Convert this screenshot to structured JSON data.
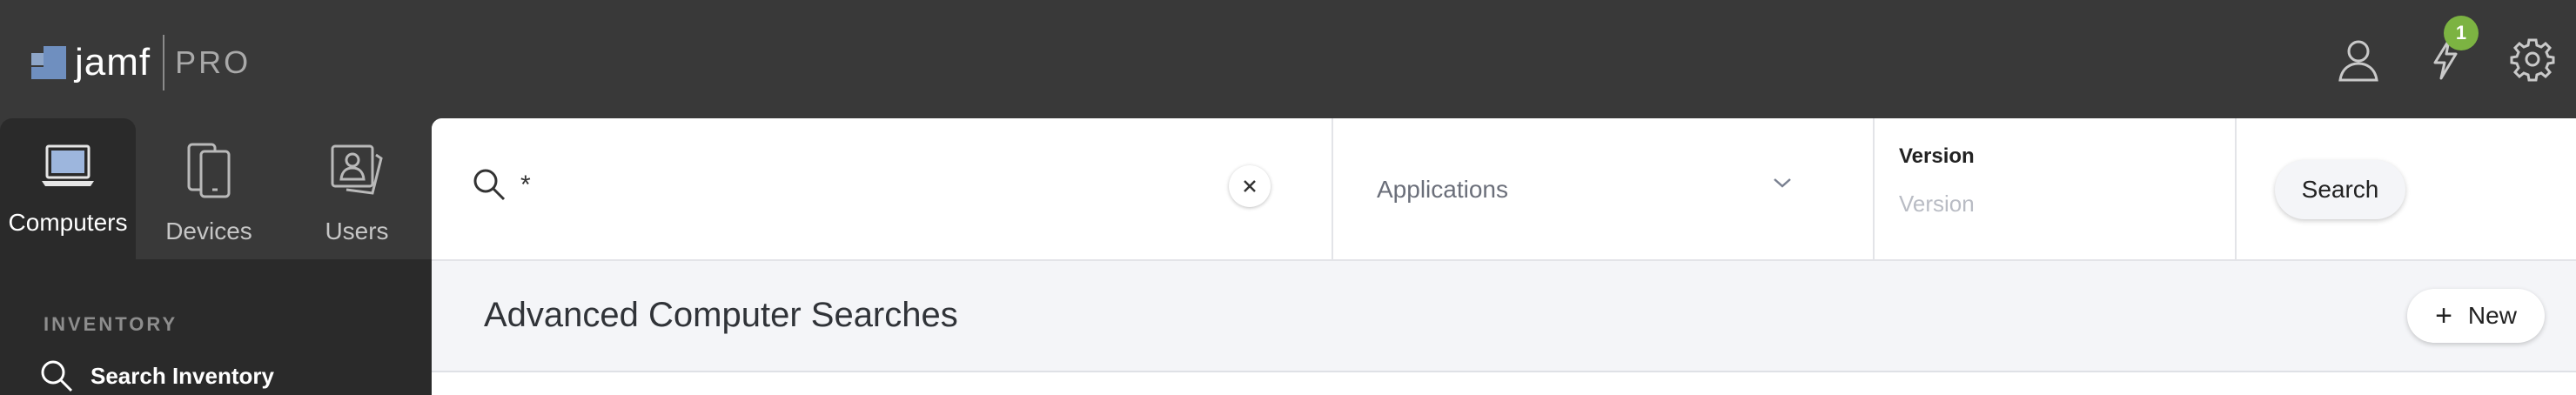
{
  "header": {
    "brand": "jamf",
    "product": "PRO",
    "notification_count": "1",
    "icons": [
      "user-account-icon",
      "lightning-notifications-icon",
      "gear-settings-icon"
    ]
  },
  "nav": {
    "tabs": [
      {
        "label": "Computers",
        "icon": "laptop-icon",
        "active": true
      },
      {
        "label": "Devices",
        "icon": "mobile-devices-icon",
        "active": false
      },
      {
        "label": "Users",
        "icon": "users-icon",
        "active": false
      }
    ]
  },
  "sidebar": {
    "section_label": "INVENTORY",
    "items": [
      {
        "label": "Search Inventory",
        "icon": "search-icon"
      }
    ]
  },
  "search": {
    "query": "*",
    "category": "Applications",
    "version_label": "Version",
    "version_placeholder": "Version",
    "search_button": "Search"
  },
  "page": {
    "title": "Advanced Computer Searches",
    "new_button": "New"
  },
  "colors": {
    "header_bg": "#393939",
    "sidebar_bg": "#2a2a2a",
    "badge": "#7cb342",
    "main_bg": "#f4f5f8"
  }
}
